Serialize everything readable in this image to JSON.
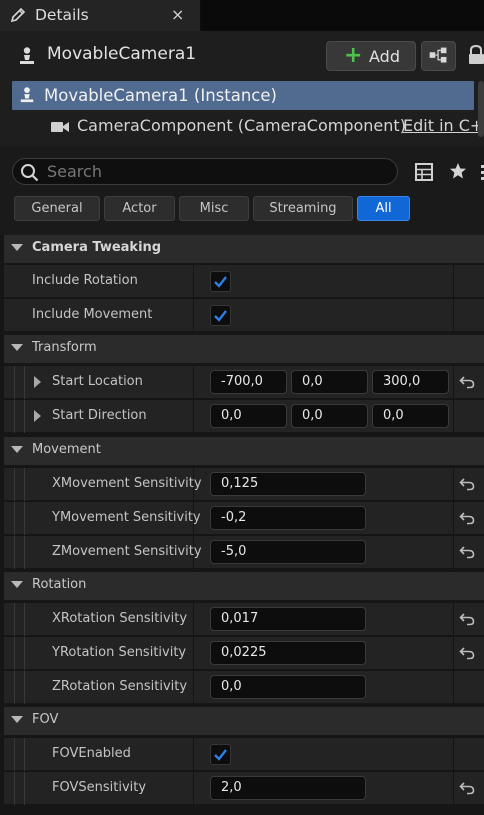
{
  "tab": {
    "title": "Details",
    "close": "×"
  },
  "header": {
    "actor_name": "MovableCamera1",
    "add_label": "Add",
    "add_plus": "+"
  },
  "tree": {
    "instance": "MovableCamera1 (Instance)",
    "component": "CameraComponent (CameraComponent)",
    "edit_link": "Edit in C+"
  },
  "search": {
    "placeholder": "Search"
  },
  "filters": {
    "items": [
      "General",
      "Actor",
      "Misc",
      "Streaming",
      "All"
    ],
    "active": "All"
  },
  "categories": {
    "camera_tweaking": "Camera Tweaking",
    "transform": "Transform",
    "movement": "Movement",
    "rotation": "Rotation",
    "fov": "FOV"
  },
  "properties": {
    "include_rotation": {
      "label": "Include Rotation",
      "checked": true
    },
    "include_movement": {
      "label": "Include Movement",
      "checked": true
    },
    "start_location": {
      "label": "Start Location",
      "x": "-700,0",
      "y": "0,0",
      "z": "300,0"
    },
    "start_direction": {
      "label": "Start Direction",
      "x": "0,0",
      "y": "0,0",
      "z": "0,0"
    },
    "xmovement": {
      "label": "XMovement Sensitivity",
      "value": "0,125"
    },
    "ymovement": {
      "label": "YMovement Sensitivity",
      "value": "-0,2"
    },
    "zmovement": {
      "label": "ZMovement Sensitivity",
      "value": "-5,0"
    },
    "xrotation": {
      "label": "XRotation Sensitivity",
      "value": "0,017"
    },
    "yrotation": {
      "label": "YRotation Sensitivity",
      "value": "0,0225"
    },
    "zrotation": {
      "label": "ZRotation Sensitivity",
      "value": "0,0"
    },
    "fov_enabled": {
      "label": "FOVEnabled",
      "checked": true
    },
    "fov_sensitivity": {
      "label": "FOVSensitivity",
      "value": "2,0"
    }
  },
  "colors": {
    "accent": "#1167d6",
    "selection": "#506b8f",
    "add_plus": "#4cc24c",
    "checkbox": "#2e7fe6"
  },
  "icons": [
    "pencil-icon",
    "close-icon",
    "actor-icon",
    "blueprint-icon",
    "lock-icon",
    "camera-icon",
    "search-icon",
    "table-view-icon",
    "star-icon",
    "more-icon",
    "reset-arrow-icon",
    "checkmark-icon",
    "collapse-arrow-icon",
    "expand-arrow-icon"
  ]
}
